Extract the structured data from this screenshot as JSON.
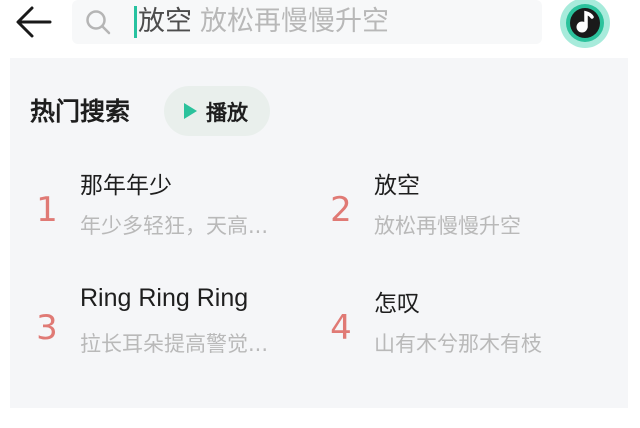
{
  "search": {
    "typed": "放空",
    "hint": "放松再慢慢升空"
  },
  "hot_search": {
    "title": "热门搜索",
    "play_label": "播放",
    "items": [
      {
        "rank": "1",
        "song": "那年年少",
        "desc": "年少多轻狂，天高..."
      },
      {
        "rank": "2",
        "song": "放空",
        "desc": "放松再慢慢升空"
      },
      {
        "rank": "3",
        "song": "Ring Ring Ring",
        "desc": "拉长耳朵提高警觉..."
      },
      {
        "rank": "4",
        "song": "怎叹",
        "desc": "山有木兮那木有枝"
      }
    ]
  },
  "colors": {
    "accent": "#27c2a0",
    "rank": "#e07a75",
    "hint": "#b8b8b8"
  },
  "icons": {
    "back": "back-arrow-icon",
    "search": "search-icon",
    "music": "music-note-icon",
    "play": "play-icon"
  }
}
